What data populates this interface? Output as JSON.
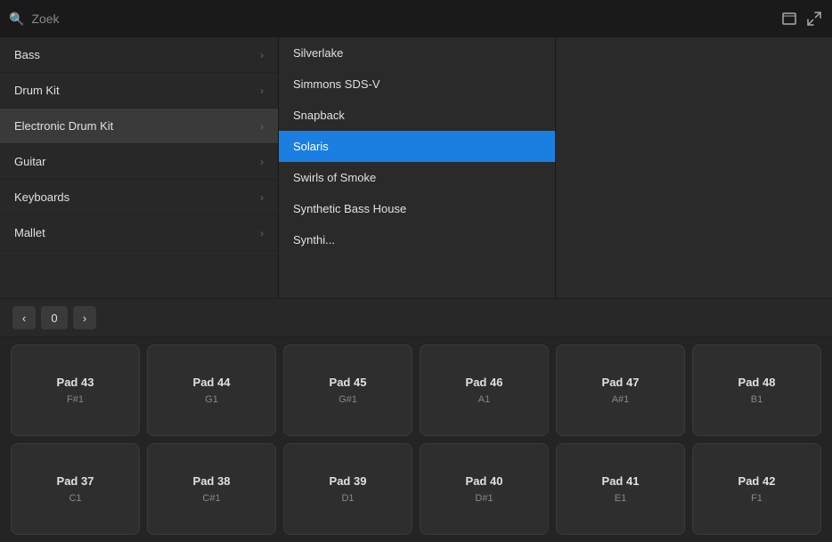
{
  "search": {
    "placeholder": "Zoek",
    "value": ""
  },
  "toolbar": {
    "icon1": "⬛",
    "icon2": "↗"
  },
  "sidebar": {
    "items": [
      {
        "label": "Bass",
        "active": false
      },
      {
        "label": "Drum Kit",
        "active": false
      },
      {
        "label": "Electronic Drum Kit",
        "active": true
      },
      {
        "label": "Guitar",
        "active": false
      },
      {
        "label": "Keyboards",
        "active": false
      },
      {
        "label": "Mallet",
        "active": false
      }
    ]
  },
  "dropdown": {
    "items": [
      {
        "label": "Silverlake",
        "selected": false
      },
      {
        "label": "Simmons SDS-V",
        "selected": false
      },
      {
        "label": "Snapback",
        "selected": false
      },
      {
        "label": "Solaris",
        "selected": true
      },
      {
        "label": "Swirls of Smoke",
        "selected": false
      },
      {
        "label": "Synthetic Bass House",
        "selected": false
      },
      {
        "label": "Synthi...",
        "selected": false
      }
    ]
  },
  "pagination": {
    "prev_label": "‹",
    "next_label": "›",
    "current_page": "0"
  },
  "pads_row1": [
    {
      "name": "Pad 43",
      "note": "F#1"
    },
    {
      "name": "Pad 44",
      "note": "G1"
    },
    {
      "name": "Pad 45",
      "note": "G#1"
    },
    {
      "name": "Pad 46",
      "note": "A1"
    },
    {
      "name": "Pad 47",
      "note": "A#1"
    },
    {
      "name": "Pad 48",
      "note": "B1"
    }
  ],
  "pads_row2": [
    {
      "name": "Pad 37",
      "note": "C1"
    },
    {
      "name": "Pad 38",
      "note": "C#1"
    },
    {
      "name": "Pad 39",
      "note": "D1"
    },
    {
      "name": "Pad 40",
      "note": "D#1"
    },
    {
      "name": "Pad 41",
      "note": "E1"
    },
    {
      "name": "Pad 42",
      "note": "F1"
    }
  ]
}
